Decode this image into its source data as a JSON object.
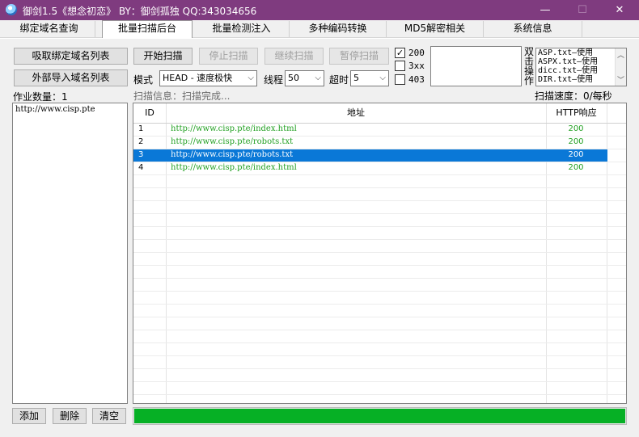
{
  "window": {
    "title": "御剑1.5《想念初恋》 BY：御剑孤独 QQ:343034656",
    "minimize": "—",
    "maximize": "☐",
    "close": "✕"
  },
  "tabs": [
    {
      "label": "绑定域名查询",
      "active": false
    },
    {
      "label": "批量扫描后台",
      "active": true
    },
    {
      "label": "批量检测注入",
      "active": false
    },
    {
      "label": "多种编码转换",
      "active": false
    },
    {
      "label": "MD5解密相关",
      "active": false
    },
    {
      "label": "系统信息",
      "active": false
    }
  ],
  "left": {
    "fetch_button": "吸取绑定域名列表",
    "import_button": "外部导入域名列表",
    "job_count_label": "作业数量：1",
    "domains": [
      "http://www.cisp.pte"
    ],
    "add_button": "添加",
    "delete_button": "删除",
    "clear_button": "清空"
  },
  "controls": {
    "start_button": "开始扫描",
    "stop_button": "停止扫描",
    "resume_button": "继续扫描",
    "pause_button": "暂停扫描",
    "mode_label": "模式",
    "mode_value": "HEAD - 速度极快",
    "threads_label": "线程",
    "threads_value": "50",
    "timeout_label": "超时",
    "timeout_value": "5",
    "status_filters": [
      {
        "label": "200",
        "checked": true
      },
      {
        "label": "3xx",
        "checked": false
      },
      {
        "label": "403",
        "checked": false
      }
    ],
    "dict_side_label": "双击操作",
    "dictionaries": [
      "ASP.txt—使用",
      "ASPX.txt—使用",
      "dicc.txt—使用",
      "DIR.txt—使用"
    ]
  },
  "status": {
    "scan_info": "扫描信息：扫描完成...",
    "scan_speed": "扫描速度：0/每秒"
  },
  "results": {
    "columns": [
      "ID",
      "地址",
      "HTTP响应"
    ],
    "rows": [
      {
        "id": "1",
        "url": "http://www.cisp.pte/index.html",
        "code": "200",
        "selected": false
      },
      {
        "id": "2",
        "url": "http://www.cisp.pte/robots.txt",
        "code": "200",
        "selected": false
      },
      {
        "id": "3",
        "url": "http://www.cisp.pte/robots.txt",
        "code": "200",
        "selected": true
      },
      {
        "id": "4",
        "url": "http://www.cisp.pte/index.html",
        "code": "200",
        "selected": false
      }
    ]
  },
  "progress": {
    "value": 1.0,
    "color": "#06b025"
  },
  "colors": {
    "titlebar": "#7f3b7f",
    "selection": "#0a78d7",
    "url_text": "#22a022"
  }
}
